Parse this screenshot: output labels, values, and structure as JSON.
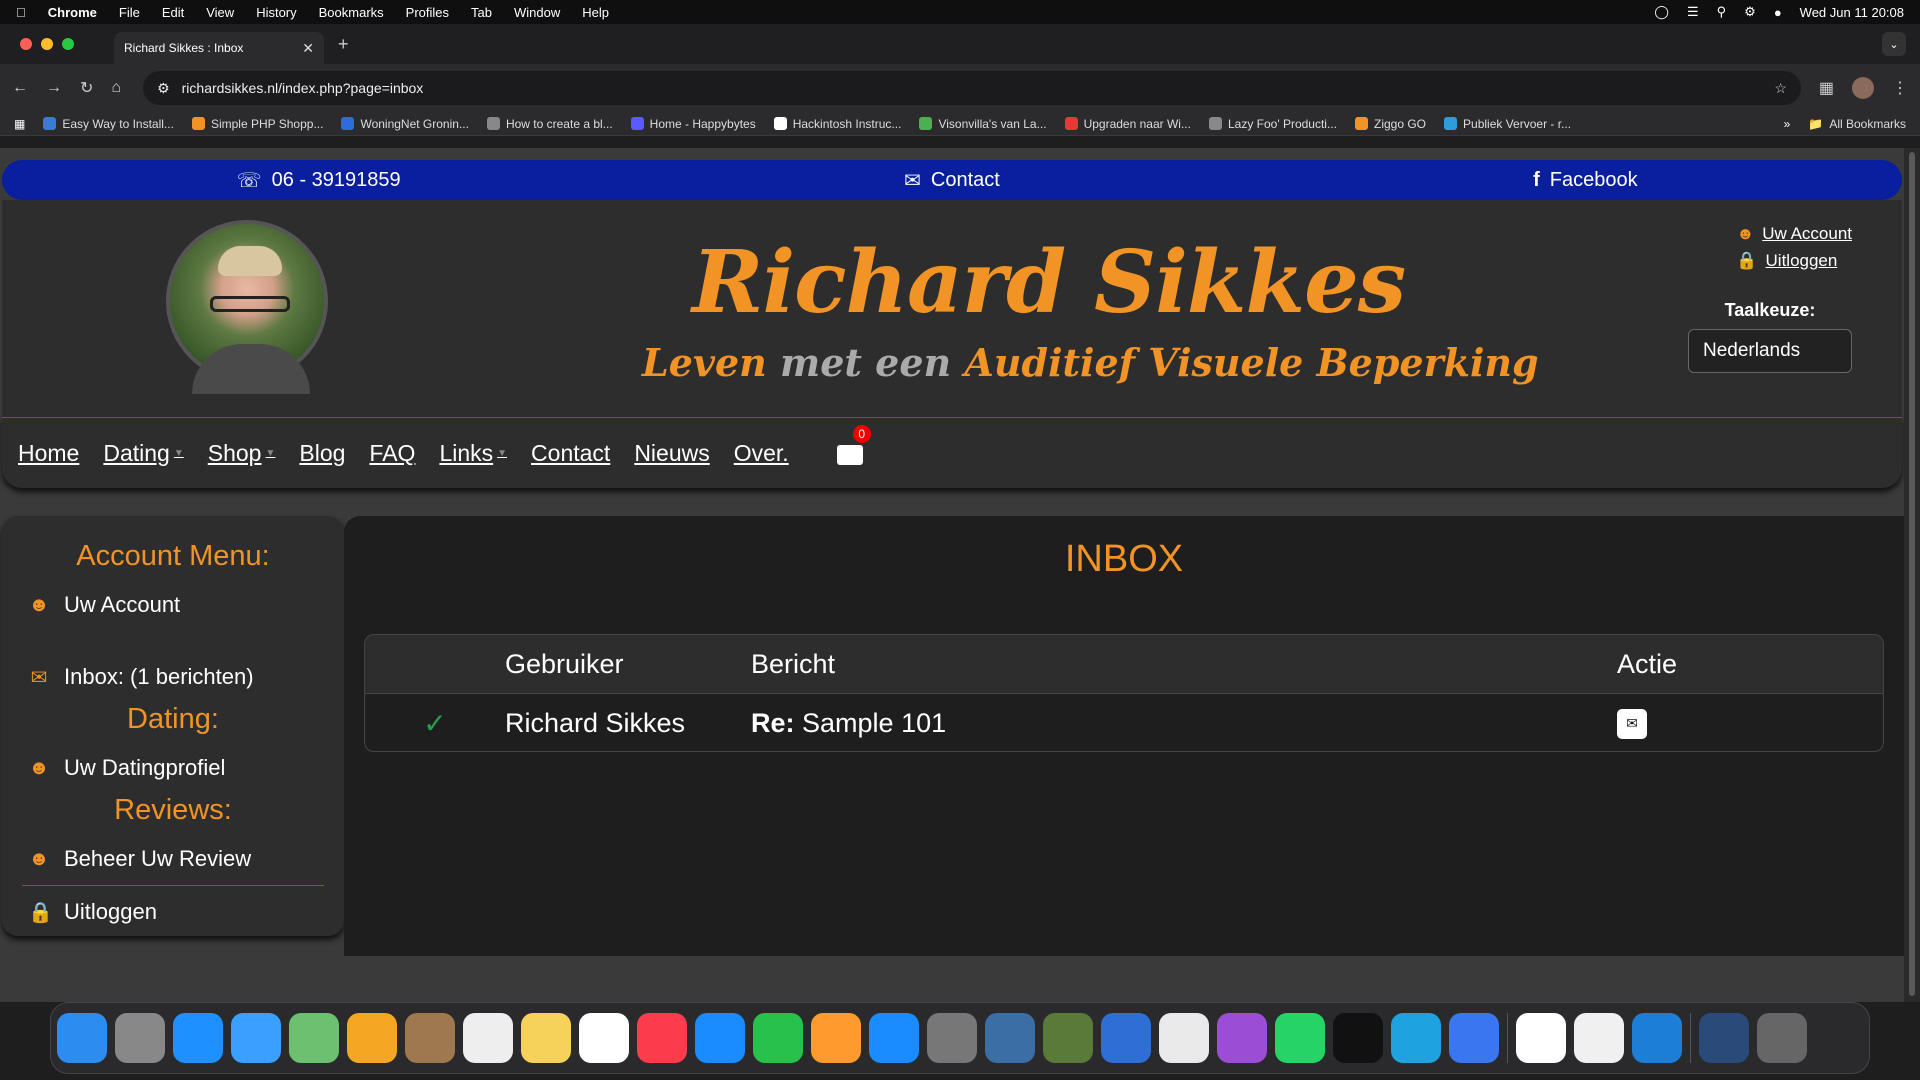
{
  "menubar": {
    "app": "Chrome",
    "items": [
      "File",
      "Edit",
      "View",
      "History",
      "Bookmarks",
      "Profiles",
      "Tab",
      "Window",
      "Help"
    ],
    "datetime": "Wed Jun 11  20:08"
  },
  "browser": {
    "tab_title": "Richard Sikkes : Inbox",
    "url": "richardsikkes.nl/index.php?page=inbox",
    "bookmarks": [
      {
        "label": "Easy Way to Install...",
        "color": "#3a7bd5"
      },
      {
        "label": "Simple PHP Shopp...",
        "color": "#f29325"
      },
      {
        "label": "WoningNet Gronin...",
        "color": "#2d6cdf"
      },
      {
        "label": "How to create a bl...",
        "color": "#888888"
      },
      {
        "label": "Home - Happybytes",
        "color": "#5a5aff"
      },
      {
        "label": "Hackintosh Instruc...",
        "color": "#ffffff"
      },
      {
        "label": "Visonvilla's van La...",
        "color": "#4caf50"
      },
      {
        "label": "Upgraden naar Wi...",
        "color": "#e53935"
      },
      {
        "label": "Lazy Foo' Producti...",
        "color": "#888888"
      },
      {
        "label": "Ziggo GO",
        "color": "#f29325"
      },
      {
        "label": "Publiek Vervoer - r...",
        "color": "#2d9cdb"
      }
    ],
    "all_bookmarks": "All Bookmarks"
  },
  "site": {
    "topbar": {
      "phone": "06 - 39191859",
      "contact": "Contact",
      "facebook": "Facebook"
    },
    "title_a": "Ri",
    "title_b": "chard Sikkes",
    "subtitle_a": "Leven",
    "subtitle_b": " met een ",
    "subtitle_c": "Auditief ",
    "subtitle_d": "Visuele ",
    "subtitle_e": "Beperking",
    "account_link": "Uw Account",
    "logout_link": "Uitloggen",
    "language_label": "Taalkeuze:",
    "language_value": "Nederlands",
    "nav": [
      "Home",
      "Dating",
      "Shop",
      "Blog",
      "FAQ",
      "Links",
      "Contact",
      "Nieuws",
      "Over."
    ],
    "cart_count": "0"
  },
  "sidebar": {
    "heading_account": "Account Menu:",
    "uw_account": "Uw Account",
    "inbox": "Inbox: (1 berichten)",
    "heading_dating": "Dating:",
    "datingprofiel": "Uw Datingprofiel",
    "heading_reviews": "Reviews:",
    "beheer_review": "Beheer Uw Review",
    "uitloggen": "Uitloggen"
  },
  "inbox": {
    "title": "INBOX",
    "columns": [
      "Gebruiker",
      "Bericht",
      "Actie"
    ],
    "rows": [
      {
        "user": "Richard Sikkes",
        "re": "Re:",
        "subject": " Sample 101"
      }
    ]
  }
}
